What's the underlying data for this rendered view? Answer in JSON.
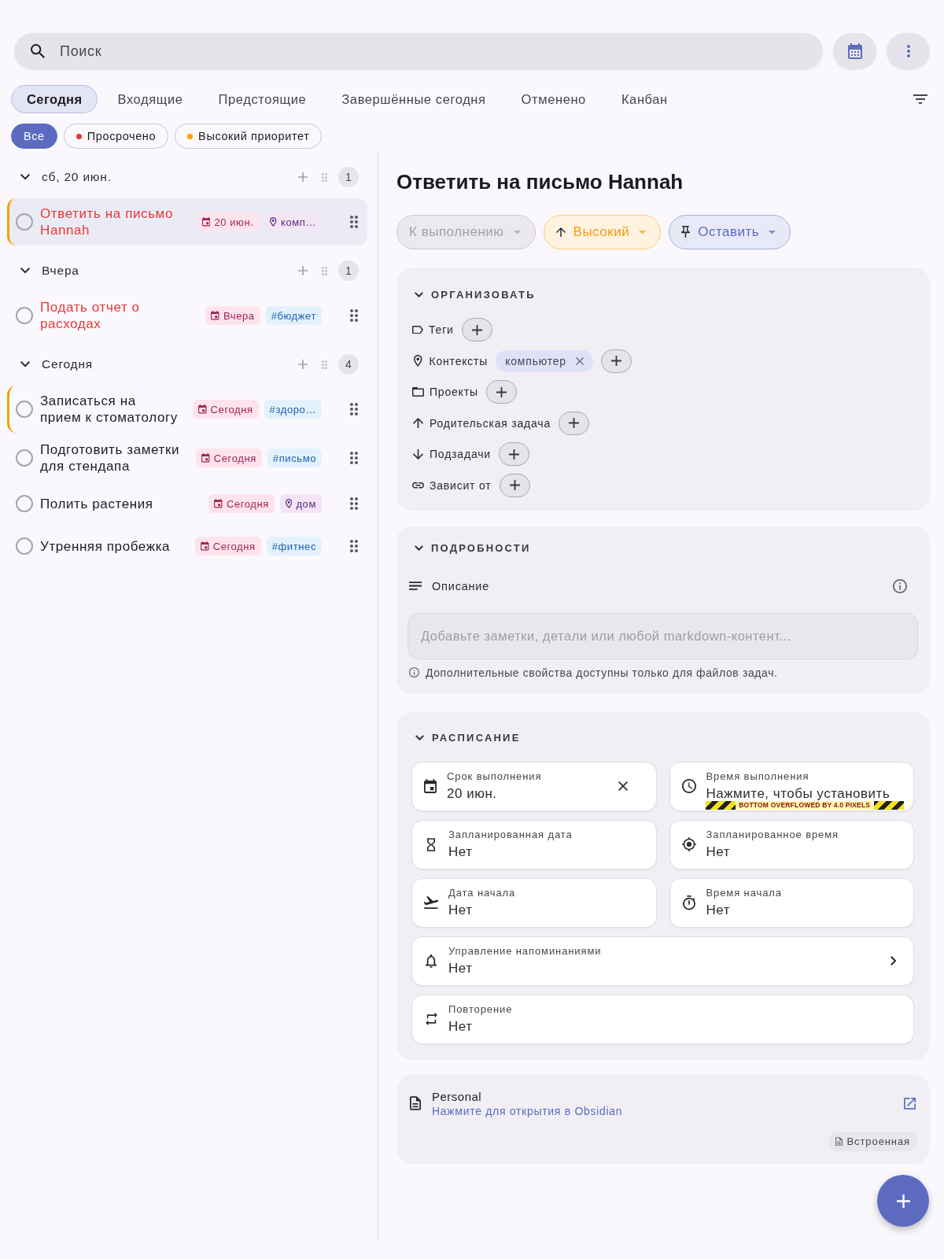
{
  "search": {
    "placeholder": "Поиск"
  },
  "tabs": [
    {
      "label": "Сегодня",
      "selected": true
    },
    {
      "label": "Входящие",
      "selected": false
    },
    {
      "label": "Предстоящие",
      "selected": false
    },
    {
      "label": "Завершённые сегодня",
      "selected": false
    },
    {
      "label": "Отменено",
      "selected": false
    },
    {
      "label": "Канбан",
      "selected": false
    }
  ],
  "filters": [
    {
      "label": "Все",
      "selected": true
    },
    {
      "label": "Просрочено",
      "selected": false,
      "color": "#e53935"
    },
    {
      "label": "Высокий приоритет",
      "selected": false,
      "color": "#ffa000"
    }
  ],
  "task_groups": [
    {
      "title": "сб, 20 июн.",
      "count": "1",
      "expanded": true,
      "tasks": [
        {
          "title": "Ответить на письмо Hannah",
          "done": false,
          "overdue": true,
          "high_priority": true,
          "selected": true,
          "chips": [
            {
              "kind": "date",
              "label": "20 июн."
            },
            {
              "kind": "context",
              "label": "комп…"
            }
          ]
        }
      ]
    },
    {
      "title": "Вчера",
      "count": "1",
      "expanded": true,
      "tasks": [
        {
          "title": "Подать отчет о расходах",
          "done": false,
          "overdue": true,
          "high_priority": false,
          "selected": false,
          "chips": [
            {
              "kind": "date",
              "label": "Вчера"
            },
            {
              "kind": "tag",
              "label": "#бюджет"
            }
          ]
        }
      ]
    },
    {
      "title": "Сегодня",
      "count": "4",
      "expanded": true,
      "tasks": [
        {
          "title": "Записаться на прием к стоматологу",
          "done": false,
          "overdue": false,
          "high_priority": true,
          "selected": false,
          "chips": [
            {
              "kind": "date",
              "label": "Сегодня"
            },
            {
              "kind": "tag",
              "label": "#здоро…"
            }
          ]
        },
        {
          "title": "Подготовить заметки для стендапа",
          "done": false,
          "overdue": false,
          "high_priority": false,
          "selected": false,
          "chips": [
            {
              "kind": "date",
              "label": "Сегодня"
            },
            {
              "kind": "tag",
              "label": "#письмо"
            }
          ]
        },
        {
          "title": "Полить растения",
          "done": false,
          "overdue": false,
          "high_priority": false,
          "selected": false,
          "chips": [
            {
              "kind": "date",
              "label": "Сегодня"
            },
            {
              "kind": "context",
              "label": "дом"
            }
          ]
        },
        {
          "title": "Утренняя пробежка",
          "done": false,
          "overdue": false,
          "high_priority": false,
          "selected": false,
          "chips": [
            {
              "kind": "date",
              "label": "Сегодня"
            },
            {
              "kind": "tag",
              "label": "#фитнес"
            }
          ]
        }
      ]
    }
  ],
  "detail": {
    "title": "Ответить на письмо Hannah",
    "pills": [
      {
        "kind": "status",
        "label": "К выполнению"
      },
      {
        "kind": "priority",
        "label": "Высокий"
      },
      {
        "kind": "pin",
        "label": "Оставить"
      }
    ],
    "organize": {
      "heading": "ОРГАНИЗОВАТЬ",
      "expanded": true,
      "rows": [
        {
          "kind": "tags",
          "label": "Теги"
        },
        {
          "kind": "contexts",
          "label": "Контексты",
          "values": [
            "компьютер"
          ]
        },
        {
          "kind": "projects",
          "label": "Проекты"
        },
        {
          "kind": "parent",
          "label": "Родительская задача"
        },
        {
          "kind": "subtasks",
          "label": "Подзадачи"
        },
        {
          "kind": "depends_on",
          "label": "Зависит от"
        }
      ]
    },
    "details": {
      "heading": "ПОДРОБНОСТИ",
      "expanded": true,
      "description_label": "Описание",
      "description": {
        "placeholder": "Добавьте заметки, детали или любой markdown-контент..."
      },
      "hint": "Дополнительные свойства доступны только для файлов задач."
    },
    "schedule": {
      "heading": "РАСПИСАНИЕ",
      "expanded": true,
      "fields": [
        {
          "kind": "due_date",
          "label": "Срок выполнения",
          "value": "20 июн.",
          "clearable": true,
          "has_submenu": false
        },
        {
          "kind": "due_time",
          "label": "Время выполнения",
          "value": "Нажмите, чтобы установить",
          "overflow_warning": "BOTTOM OVERFLOWED BY 4.0 PIXELS",
          "clearable": false,
          "has_submenu": false
        },
        {
          "kind": "scheduled_date",
          "label": "Запланированная дата",
          "value": "Нет",
          "clearable": false,
          "has_submenu": false
        },
        {
          "kind": "scheduled_time",
          "label": "Запланированное время",
          "value": "Нет",
          "clearable": false,
          "has_submenu": false
        },
        {
          "kind": "start_date",
          "label": "Дата начала",
          "value": "Нет",
          "clearable": false,
          "has_submenu": false
        },
        {
          "kind": "start_time",
          "label": "Время начала",
          "value": "Нет",
          "clearable": false,
          "has_submenu": false
        },
        {
          "kind": "reminders",
          "label": "Управление напоминаниями",
          "value": "Нет",
          "clearable": false,
          "has_submenu": true
        },
        {
          "kind": "recurrence",
          "label": "Повторение",
          "value": "Нет",
          "clearable": false,
          "has_submenu": false
        }
      ]
    },
    "file": {
      "name": "Personal",
      "link": "Нажмите для открытия в Obsidian",
      "badge": "Встроенная"
    }
  }
}
